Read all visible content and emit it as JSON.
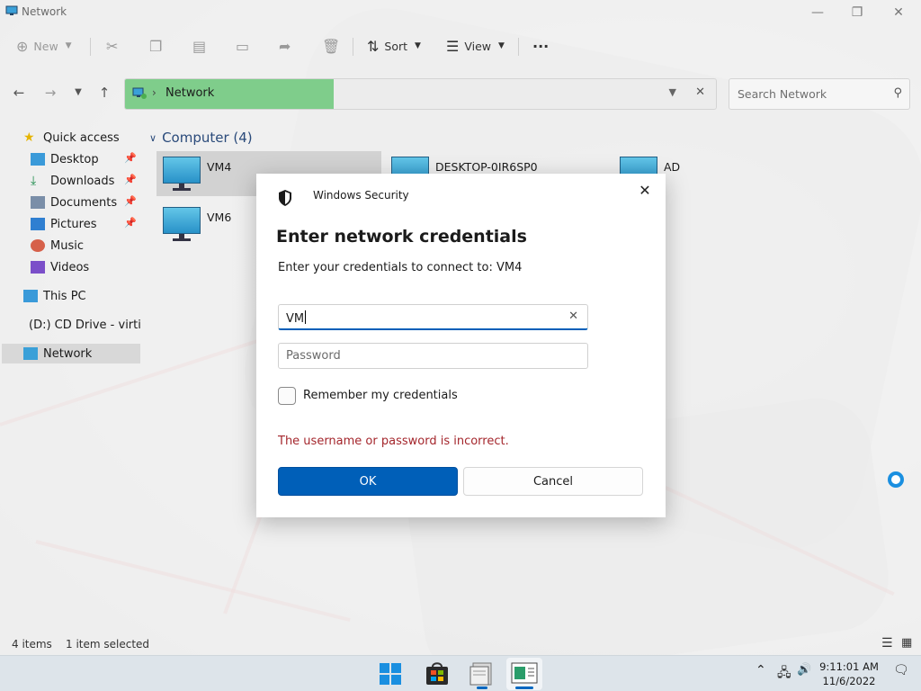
{
  "window": {
    "title": "Network"
  },
  "commandbar": {
    "new": "New",
    "sort": "Sort",
    "view": "View",
    "more": "···"
  },
  "address": {
    "breadcrumb": "Network"
  },
  "search": {
    "placeholder": "Search Network"
  },
  "sidebar": {
    "items": [
      {
        "label": "Quick access",
        "icon": "star-icon"
      },
      {
        "label": "Desktop",
        "icon": "desktop-folder-icon",
        "pinned": true
      },
      {
        "label": "Downloads",
        "icon": "downloads-icon",
        "pinned": true
      },
      {
        "label": "Documents",
        "icon": "documents-icon",
        "pinned": true
      },
      {
        "label": "Pictures",
        "icon": "pictures-icon",
        "pinned": true
      },
      {
        "label": "Music",
        "icon": "music-icon"
      },
      {
        "label": "Videos",
        "icon": "videos-icon"
      },
      {
        "label": "This PC",
        "icon": "pc-icon"
      },
      {
        "label": "(D:) CD Drive - virti",
        "icon": "cd-drive-icon"
      },
      {
        "label": "Network",
        "icon": "network-icon",
        "selected": true
      }
    ]
  },
  "content": {
    "group_header": "Computer (4)",
    "computers": [
      "VM4",
      "DESKTOP-0IR6SP0",
      "AD",
      "VM6"
    ]
  },
  "status": {
    "items": "4 items",
    "selected": "1 item selected"
  },
  "dialog": {
    "app_title": "Windows Security",
    "heading": "Enter network credentials",
    "subtitle": "Enter your credentials to connect to: VM4",
    "username_value": "VM",
    "password_placeholder": "Password",
    "remember_label": "Remember my credentials",
    "error": "The username or password is incorrect.",
    "ok_label": "OK",
    "cancel_label": "Cancel"
  },
  "taskbar": {
    "time": "9:11:01 AM",
    "date": "11/6/2022"
  },
  "colors": {
    "accent": "#005fb8",
    "error": "#a4262c",
    "address_highlight": "#7fcd8b"
  }
}
